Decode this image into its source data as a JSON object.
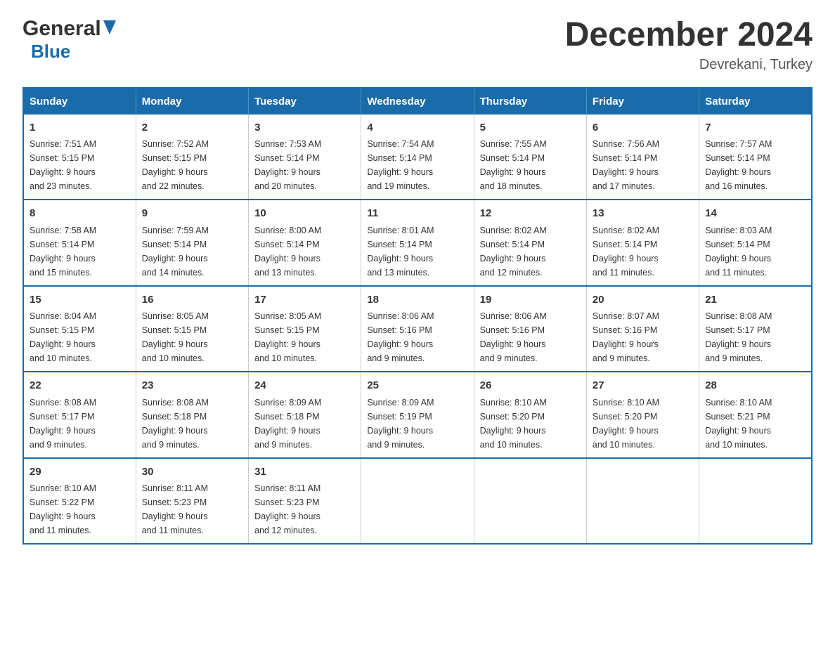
{
  "header": {
    "logo": {
      "general_text": "General",
      "blue_text": "Blue"
    },
    "title": "December 2024",
    "location": "Devrekani, Turkey"
  },
  "calendar": {
    "days_of_week": [
      "Sunday",
      "Monday",
      "Tuesday",
      "Wednesday",
      "Thursday",
      "Friday",
      "Saturday"
    ],
    "weeks": [
      [
        {
          "day": "1",
          "sunrise": "Sunrise: 7:51 AM",
          "sunset": "Sunset: 5:15 PM",
          "daylight": "Daylight: 9 hours",
          "daylight2": "and 23 minutes."
        },
        {
          "day": "2",
          "sunrise": "Sunrise: 7:52 AM",
          "sunset": "Sunset: 5:15 PM",
          "daylight": "Daylight: 9 hours",
          "daylight2": "and 22 minutes."
        },
        {
          "day": "3",
          "sunrise": "Sunrise: 7:53 AM",
          "sunset": "Sunset: 5:14 PM",
          "daylight": "Daylight: 9 hours",
          "daylight2": "and 20 minutes."
        },
        {
          "day": "4",
          "sunrise": "Sunrise: 7:54 AM",
          "sunset": "Sunset: 5:14 PM",
          "daylight": "Daylight: 9 hours",
          "daylight2": "and 19 minutes."
        },
        {
          "day": "5",
          "sunrise": "Sunrise: 7:55 AM",
          "sunset": "Sunset: 5:14 PM",
          "daylight": "Daylight: 9 hours",
          "daylight2": "and 18 minutes."
        },
        {
          "day": "6",
          "sunrise": "Sunrise: 7:56 AM",
          "sunset": "Sunset: 5:14 PM",
          "daylight": "Daylight: 9 hours",
          "daylight2": "and 17 minutes."
        },
        {
          "day": "7",
          "sunrise": "Sunrise: 7:57 AM",
          "sunset": "Sunset: 5:14 PM",
          "daylight": "Daylight: 9 hours",
          "daylight2": "and 16 minutes."
        }
      ],
      [
        {
          "day": "8",
          "sunrise": "Sunrise: 7:58 AM",
          "sunset": "Sunset: 5:14 PM",
          "daylight": "Daylight: 9 hours",
          "daylight2": "and 15 minutes."
        },
        {
          "day": "9",
          "sunrise": "Sunrise: 7:59 AM",
          "sunset": "Sunset: 5:14 PM",
          "daylight": "Daylight: 9 hours",
          "daylight2": "and 14 minutes."
        },
        {
          "day": "10",
          "sunrise": "Sunrise: 8:00 AM",
          "sunset": "Sunset: 5:14 PM",
          "daylight": "Daylight: 9 hours",
          "daylight2": "and 13 minutes."
        },
        {
          "day": "11",
          "sunrise": "Sunrise: 8:01 AM",
          "sunset": "Sunset: 5:14 PM",
          "daylight": "Daylight: 9 hours",
          "daylight2": "and 13 minutes."
        },
        {
          "day": "12",
          "sunrise": "Sunrise: 8:02 AM",
          "sunset": "Sunset: 5:14 PM",
          "daylight": "Daylight: 9 hours",
          "daylight2": "and 12 minutes."
        },
        {
          "day": "13",
          "sunrise": "Sunrise: 8:02 AM",
          "sunset": "Sunset: 5:14 PM",
          "daylight": "Daylight: 9 hours",
          "daylight2": "and 11 minutes."
        },
        {
          "day": "14",
          "sunrise": "Sunrise: 8:03 AM",
          "sunset": "Sunset: 5:14 PM",
          "daylight": "Daylight: 9 hours",
          "daylight2": "and 11 minutes."
        }
      ],
      [
        {
          "day": "15",
          "sunrise": "Sunrise: 8:04 AM",
          "sunset": "Sunset: 5:15 PM",
          "daylight": "Daylight: 9 hours",
          "daylight2": "and 10 minutes."
        },
        {
          "day": "16",
          "sunrise": "Sunrise: 8:05 AM",
          "sunset": "Sunset: 5:15 PM",
          "daylight": "Daylight: 9 hours",
          "daylight2": "and 10 minutes."
        },
        {
          "day": "17",
          "sunrise": "Sunrise: 8:05 AM",
          "sunset": "Sunset: 5:15 PM",
          "daylight": "Daylight: 9 hours",
          "daylight2": "and 10 minutes."
        },
        {
          "day": "18",
          "sunrise": "Sunrise: 8:06 AM",
          "sunset": "Sunset: 5:16 PM",
          "daylight": "Daylight: 9 hours",
          "daylight2": "and 9 minutes."
        },
        {
          "day": "19",
          "sunrise": "Sunrise: 8:06 AM",
          "sunset": "Sunset: 5:16 PM",
          "daylight": "Daylight: 9 hours",
          "daylight2": "and 9 minutes."
        },
        {
          "day": "20",
          "sunrise": "Sunrise: 8:07 AM",
          "sunset": "Sunset: 5:16 PM",
          "daylight": "Daylight: 9 hours",
          "daylight2": "and 9 minutes."
        },
        {
          "day": "21",
          "sunrise": "Sunrise: 8:08 AM",
          "sunset": "Sunset: 5:17 PM",
          "daylight": "Daylight: 9 hours",
          "daylight2": "and 9 minutes."
        }
      ],
      [
        {
          "day": "22",
          "sunrise": "Sunrise: 8:08 AM",
          "sunset": "Sunset: 5:17 PM",
          "daylight": "Daylight: 9 hours",
          "daylight2": "and 9 minutes."
        },
        {
          "day": "23",
          "sunrise": "Sunrise: 8:08 AM",
          "sunset": "Sunset: 5:18 PM",
          "daylight": "Daylight: 9 hours",
          "daylight2": "and 9 minutes."
        },
        {
          "day": "24",
          "sunrise": "Sunrise: 8:09 AM",
          "sunset": "Sunset: 5:18 PM",
          "daylight": "Daylight: 9 hours",
          "daylight2": "and 9 minutes."
        },
        {
          "day": "25",
          "sunrise": "Sunrise: 8:09 AM",
          "sunset": "Sunset: 5:19 PM",
          "daylight": "Daylight: 9 hours",
          "daylight2": "and 9 minutes."
        },
        {
          "day": "26",
          "sunrise": "Sunrise: 8:10 AM",
          "sunset": "Sunset: 5:20 PM",
          "daylight": "Daylight: 9 hours",
          "daylight2": "and 10 minutes."
        },
        {
          "day": "27",
          "sunrise": "Sunrise: 8:10 AM",
          "sunset": "Sunset: 5:20 PM",
          "daylight": "Daylight: 9 hours",
          "daylight2": "and 10 minutes."
        },
        {
          "day": "28",
          "sunrise": "Sunrise: 8:10 AM",
          "sunset": "Sunset: 5:21 PM",
          "daylight": "Daylight: 9 hours",
          "daylight2": "and 10 minutes."
        }
      ],
      [
        {
          "day": "29",
          "sunrise": "Sunrise: 8:10 AM",
          "sunset": "Sunset: 5:22 PM",
          "daylight": "Daylight: 9 hours",
          "daylight2": "and 11 minutes."
        },
        {
          "day": "30",
          "sunrise": "Sunrise: 8:11 AM",
          "sunset": "Sunset: 5:23 PM",
          "daylight": "Daylight: 9 hours",
          "daylight2": "and 11 minutes."
        },
        {
          "day": "31",
          "sunrise": "Sunrise: 8:11 AM",
          "sunset": "Sunset: 5:23 PM",
          "daylight": "Daylight: 9 hours",
          "daylight2": "and 12 minutes."
        },
        {
          "day": "",
          "sunrise": "",
          "sunset": "",
          "daylight": "",
          "daylight2": ""
        },
        {
          "day": "",
          "sunrise": "",
          "sunset": "",
          "daylight": "",
          "daylight2": ""
        },
        {
          "day": "",
          "sunrise": "",
          "sunset": "",
          "daylight": "",
          "daylight2": ""
        },
        {
          "day": "",
          "sunrise": "",
          "sunset": "",
          "daylight": "",
          "daylight2": ""
        }
      ]
    ]
  }
}
